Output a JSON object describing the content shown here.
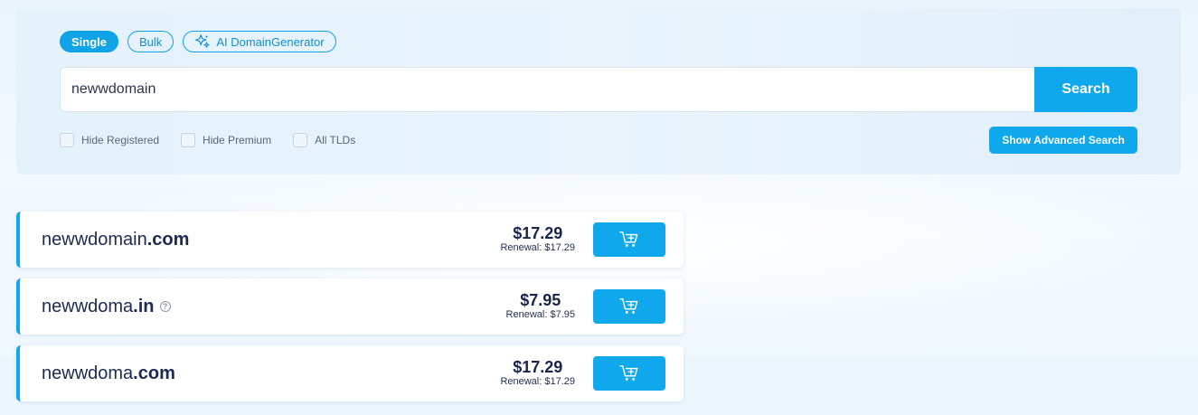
{
  "modes": [
    {
      "label": "Single",
      "active": true
    },
    {
      "label": "Bulk",
      "active": false
    },
    {
      "label": "AI DomainGenerator",
      "active": false,
      "icon": "sparkle-icon"
    }
  ],
  "search": {
    "value": "newwdomain",
    "button_label": "Search"
  },
  "filters": [
    {
      "label": "Hide Registered",
      "checked": false
    },
    {
      "label": "Hide Premium",
      "checked": false
    },
    {
      "label": "All TLDs",
      "checked": false
    }
  ],
  "advanced_search_label": "Show Advanced Search",
  "results": [
    {
      "name": "newwdomain",
      "tld": ".com",
      "help": false,
      "price": "$17.29",
      "renewal": "Renewal: $17.29"
    },
    {
      "name": "newwdoma",
      "tld": ".in",
      "help": true,
      "price": "$7.95",
      "renewal": "Renewal: $7.95"
    },
    {
      "name": "newwdoma",
      "tld": ".com",
      "help": false,
      "price": "$17.29",
      "renewal": "Renewal: $17.29"
    }
  ],
  "colors": {
    "accent": "#10a8ec",
    "text_dark": "#1b2a52",
    "panel_bg": "#e4f2fc"
  }
}
